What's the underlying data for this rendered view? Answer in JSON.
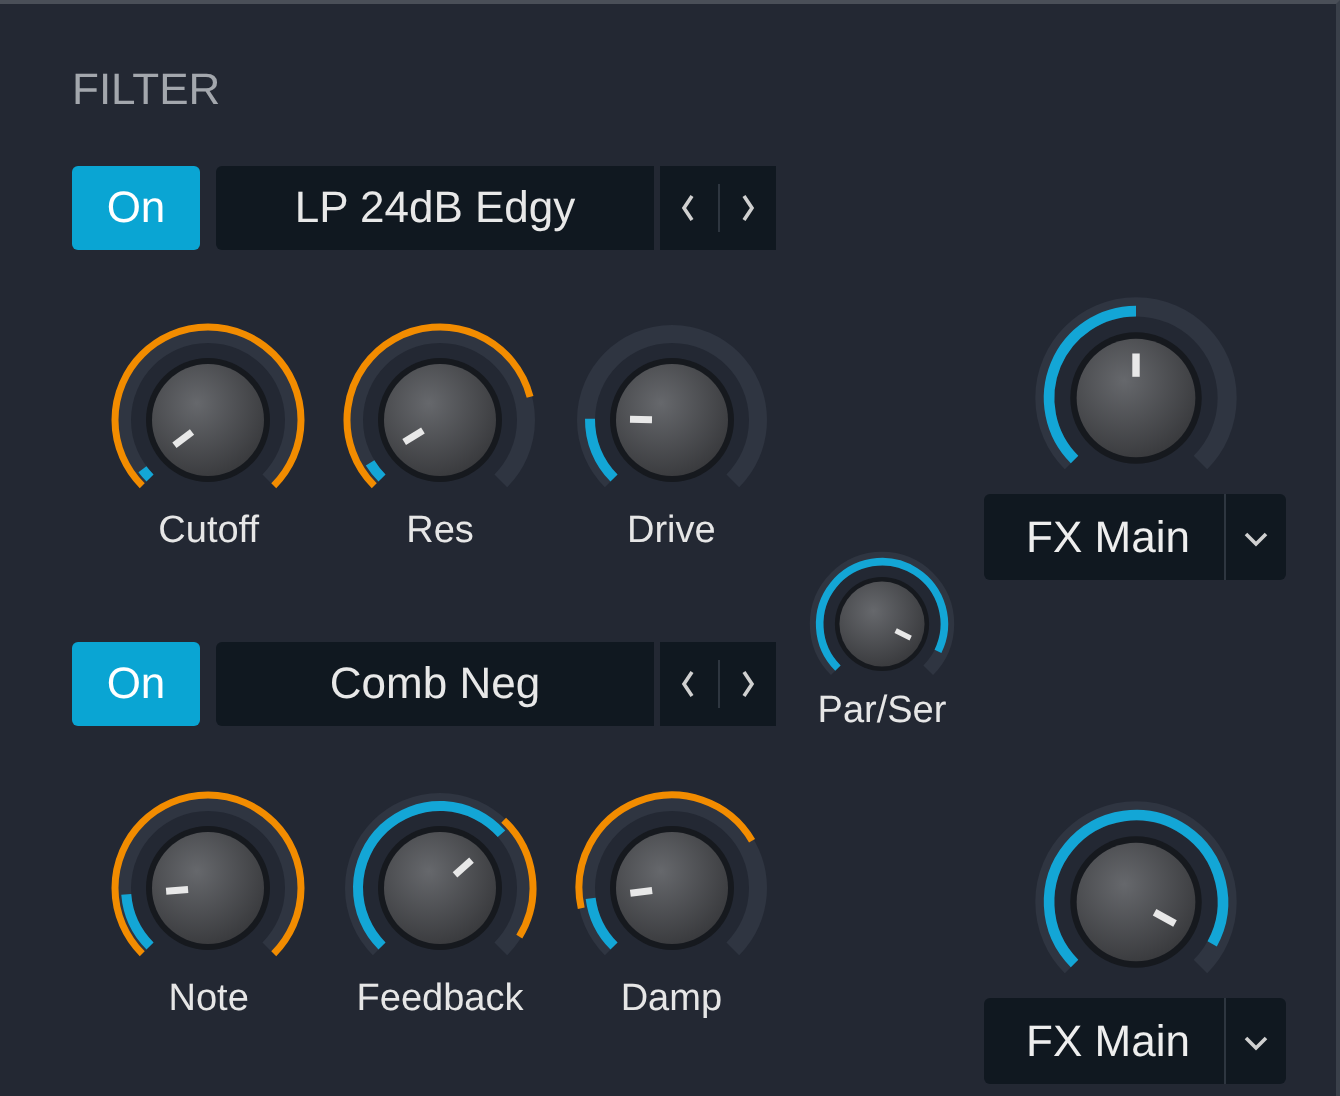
{
  "title": "FILTER",
  "filters": [
    {
      "on": true,
      "on_label": "On",
      "type": "LP 24dB Edgy",
      "knobs": [
        {
          "label": "Cutoff"
        },
        {
          "label": "Res"
        },
        {
          "label": "Drive"
        }
      ]
    },
    {
      "on": true,
      "on_label": "On",
      "type": "Comb Neg",
      "knobs": [
        {
          "label": "Note"
        },
        {
          "label": "Feedback"
        },
        {
          "label": "Damp"
        }
      ]
    }
  ],
  "par_ser": {
    "label": "Par/Ser"
  },
  "outputs": [
    {
      "destination": "FX Main"
    },
    {
      "destination": "FX Main"
    }
  ]
}
